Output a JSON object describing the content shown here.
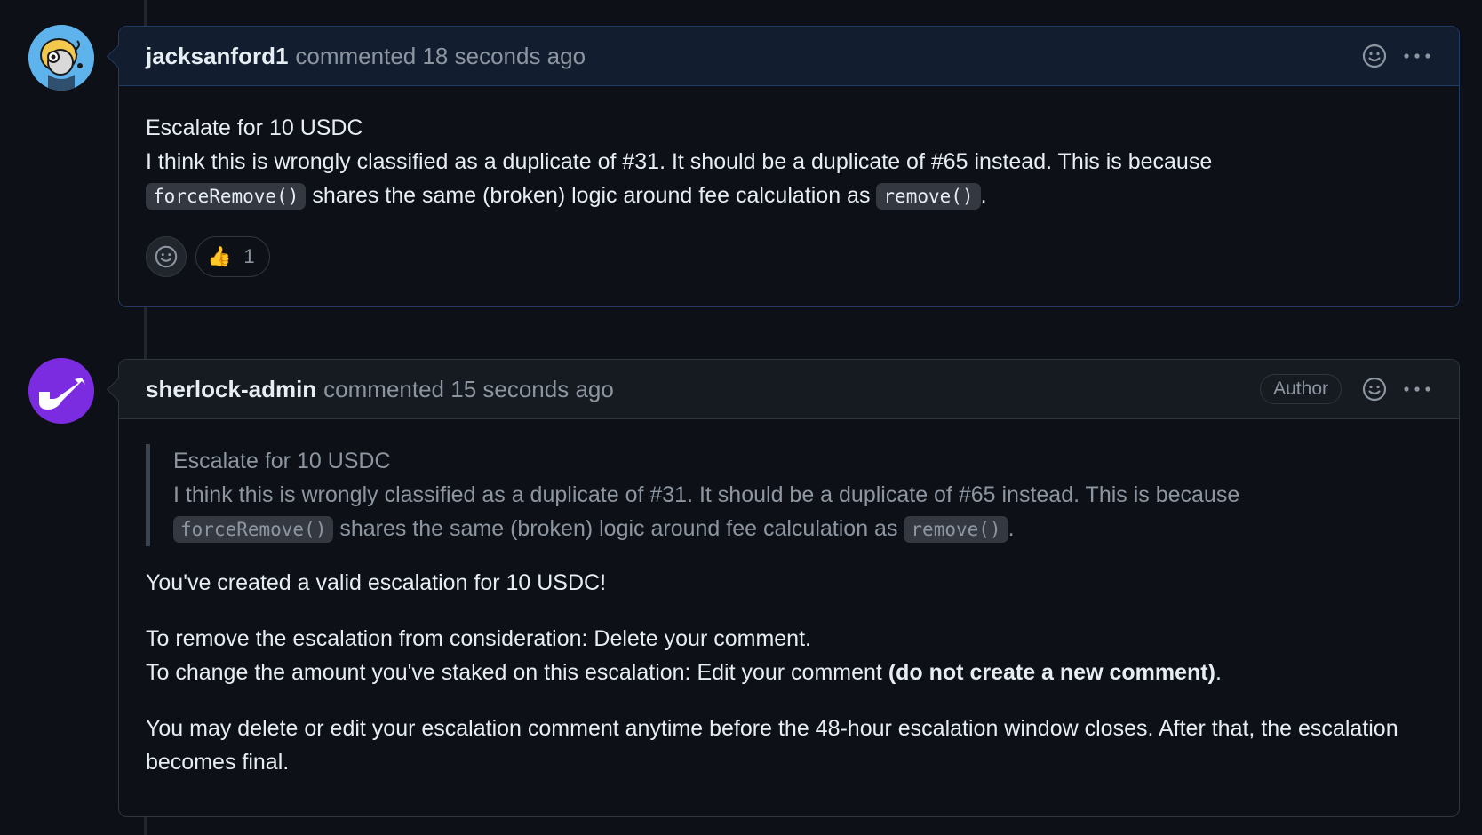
{
  "comments": [
    {
      "author": "jacksanford1",
      "meta": "commented 18 seconds ago",
      "body": {
        "line1": "Escalate for 10 USDC",
        "line2": "I think this is wrongly classified as a duplicate of #31. It should be a duplicate of #65 instead. This is because",
        "code1": "forceRemove()",
        "mid": " shares the same (broken) logic around fee calculation as ",
        "code2": "remove()",
        "end": "."
      },
      "reactions": [
        {
          "emoji": "👍",
          "count": "1"
        }
      ]
    },
    {
      "author": "sherlock-admin",
      "meta": "commented 15 seconds ago",
      "badge": "Author",
      "quote": {
        "line1": "Escalate for 10 USDC",
        "line2": "I think this is wrongly classified as a duplicate of #31. It should be a duplicate of #65 instead. This is because",
        "code1": "forceRemove()",
        "mid": " shares the same (broken) logic around fee calculation as ",
        "code2": "remove()",
        "end": "."
      },
      "p1": "You've created a valid escalation for 10 USDC!",
      "p2_line1": "To remove the escalation from consideration: Delete your comment.",
      "p2_line2_start": "To change the amount you've staked on this escalation: Edit your comment ",
      "p2_line2_bold": "(do not create a new comment)",
      "p2_line2_end": ".",
      "p3": "You may delete or edit your escalation comment anytime before the 48-hour escalation window closes. After that, the escalation becomes final."
    }
  ],
  "colors": {
    "background": "#0d1117",
    "border": "#30363d",
    "header_highlight": "#121d2f",
    "muted_text": "#8d96a0",
    "avatar_admin": "#8a2be2",
    "avatar_user": "#4ca8e8"
  },
  "icons": [
    "smiley-icon",
    "kebab-horizontal-icon",
    "thumbs-up-icon"
  ]
}
